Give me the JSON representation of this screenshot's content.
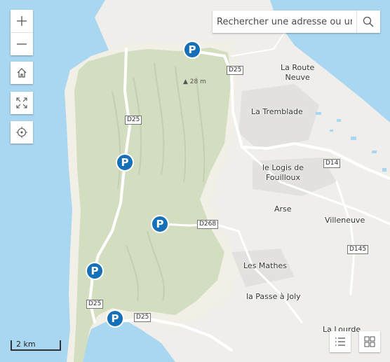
{
  "map": {
    "colors": {
      "water": "#a9d6f1",
      "forest": "#d3ddc0",
      "land": "#efeeea",
      "urban": "#e2e1dd",
      "sand": "#f2efe6",
      "road": "#ffffff",
      "parking": "#1670b8"
    },
    "places": [
      {
        "name": "La Route\nNeuve"
      },
      {
        "name": "La Tremblade"
      },
      {
        "name": "le Logis de\nFouilloux"
      },
      {
        "name": "Arse"
      },
      {
        "name": "Villeneuve"
      },
      {
        "name": "Les Mathes"
      },
      {
        "name": "la Passe à Joly"
      },
      {
        "name": "La Lourde"
      }
    ],
    "road_labels": [
      "D25",
      "D25",
      "D268",
      "D25",
      "D25",
      "D14",
      "D145"
    ],
    "elevation": "28 m",
    "parking_symbol": "P"
  },
  "controls": {
    "zoom_in_icon": "plus-icon",
    "zoom_out_icon": "minus-icon",
    "home_icon": "home-icon",
    "fullscreen_icon": "expand-icon",
    "locate_icon": "locate-icon",
    "layer_list_icon": "list-icon",
    "basemap_icon": "grid-icon"
  },
  "search": {
    "placeholder": "Rechercher une adresse ou un lieu",
    "icon": "search-icon"
  },
  "scalebar": {
    "label": "2 km"
  }
}
